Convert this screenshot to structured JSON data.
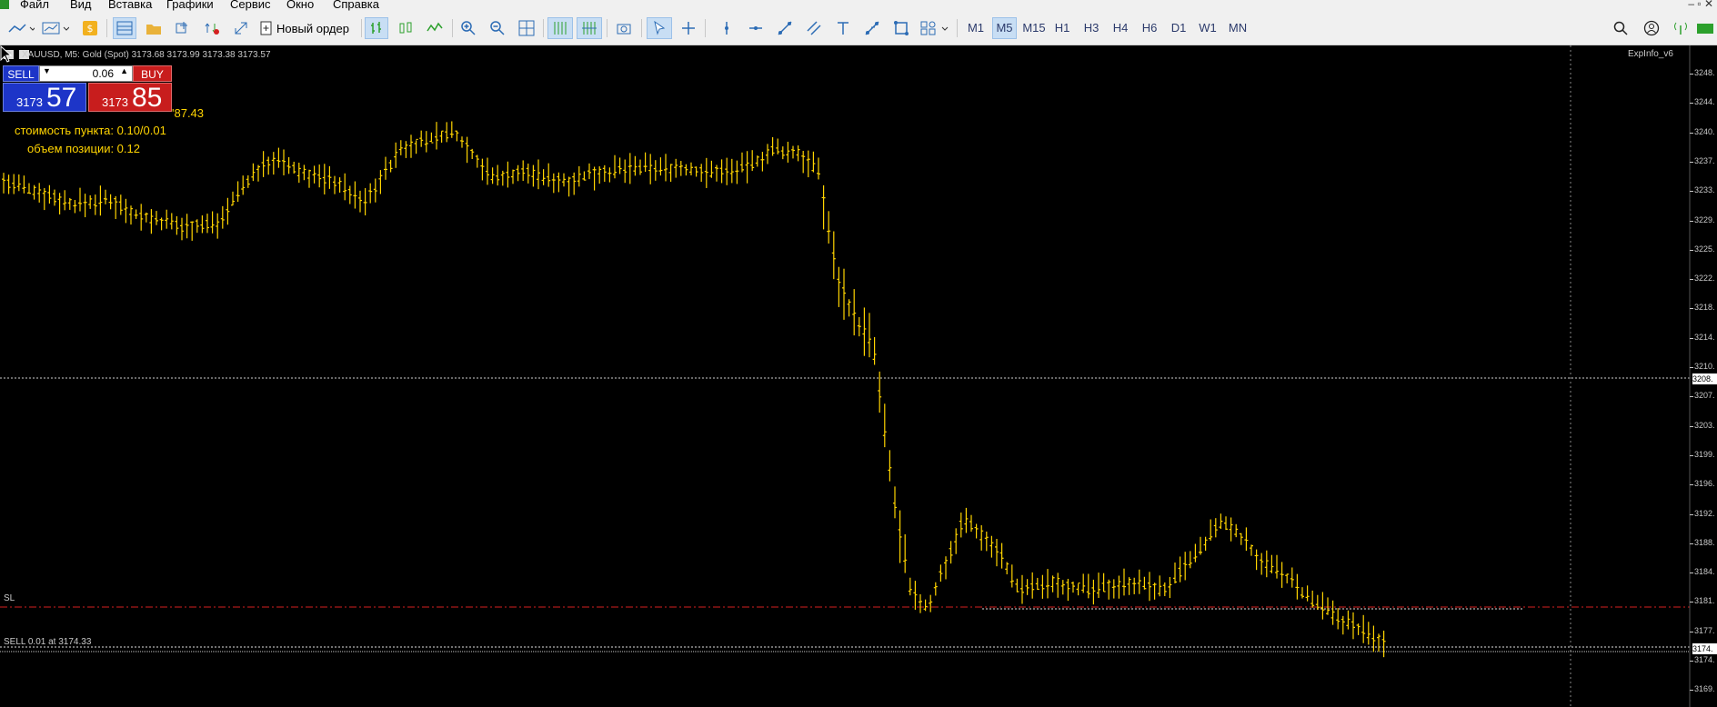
{
  "menu": {
    "items": [
      "Файл",
      "Вид",
      "Вставка",
      "Графики",
      "Сервис",
      "Окно",
      "Справка"
    ]
  },
  "toolbar": {
    "new_order_label": "Новый ордер",
    "timeframes": [
      "M1",
      "M5",
      "M15",
      "H1",
      "H3",
      "H4",
      "H6",
      "D1",
      "W1",
      "MN"
    ],
    "active_timeframe": "M5"
  },
  "chart": {
    "symbol_info": "XAUUSD, M5: Gold (Spot) 3173.68 3173.99 3173.38 3173.57",
    "ea_label": "ExpInfo_v6",
    "sl_label": "SL",
    "sell_label": "SELL 0.01 at 3174.33",
    "price_levels": [
      "3248.",
      "3244.",
      "3240.",
      "3237.",
      "3233.",
      "3229.",
      "3225.",
      "3222.",
      "3218.",
      "3214.",
      "3210.",
      "3207.",
      "3203.",
      "3199.",
      "3196.",
      "3192.",
      "3188.",
      "3184.",
      "3181.",
      "3177.",
      "3174.",
      "3169."
    ],
    "tag_hline": "3208.",
    "tag_bid": "3174.",
    "colors": {
      "bars": "#ffd400",
      "sl_line": "#d42020",
      "background": "#000000"
    }
  },
  "trade_panel": {
    "sell_label": "SELL",
    "buy_label": "BUY",
    "lot": "0.06",
    "sell_base": "3173",
    "sell_big": "57",
    "buy_base": "3173",
    "buy_big": "85",
    "spread_text": "'87.43",
    "info1": "стоимость пункта:  0.10/0.01",
    "info2": "объем позиции:  0.12"
  }
}
